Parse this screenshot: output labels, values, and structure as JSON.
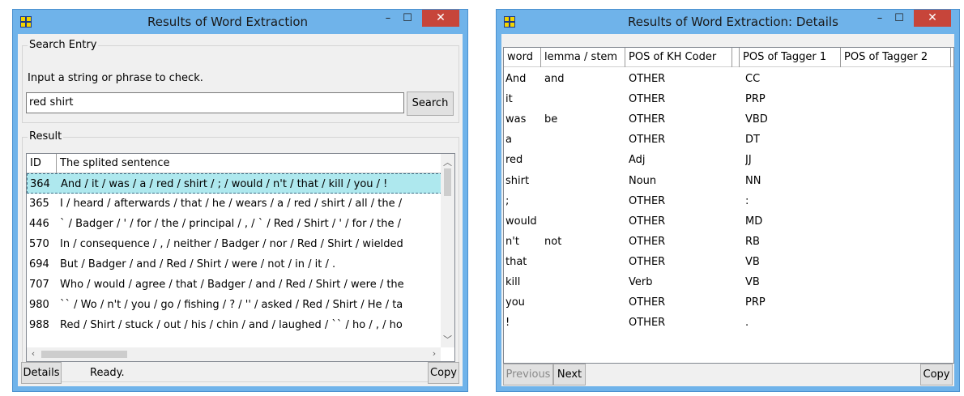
{
  "window1": {
    "title": "Results of Word Extraction",
    "search_entry_label": "Search Entry",
    "instruction": "Input a string or phrase to check.",
    "search_value": "red shirt",
    "search_button": "Search",
    "result_label": "Result",
    "columns": [
      "ID",
      "The splited sentence"
    ],
    "rows": [
      {
        "id": "364",
        "text": "And / it / was / a / red / shirt / ; / would / n't / that / kill / you / !"
      },
      {
        "id": "365",
        "text": "I / heard / afterwards / that / he / wears / a / red / shirt / all / the /"
      },
      {
        "id": "446",
        "text": "` / Badger / ' / for / the / principal / , / ` / Red / Shirt / ' / for / the /"
      },
      {
        "id": "570",
        "text": "In / consequence / , / neither / Badger / nor / Red / Shirt / wielded"
      },
      {
        "id": "694",
        "text": "But / Badger / and / Red / Shirt / were / not / in / it / ."
      },
      {
        "id": "707",
        "text": "Who / would / agree / that / Badger / and / Red / Shirt / were / the"
      },
      {
        "id": "980",
        "text": "`` / Wo / n't / you / go / fishing / ? / '' / asked / Red / Shirt / He / ta"
      },
      {
        "id": "988",
        "text": "Red / Shirt / stuck / out / his / chin / and / laughed / `` / ho / , / ho"
      }
    ],
    "details_button": "Details",
    "status": "Ready.",
    "copy_button": "Copy"
  },
  "window2": {
    "title": "Results of Word Extraction: Details",
    "columns": [
      "word",
      "lemma / stem",
      "POS of KH Coder",
      "POS of Tagger 1",
      "POS of Tagger 2"
    ],
    "rows": [
      {
        "word": "And",
        "lemma": "and",
        "kh": "OTHER",
        "t1": "CC",
        "t2": ""
      },
      {
        "word": "it",
        "lemma": "",
        "kh": "OTHER",
        "t1": "PRP",
        "t2": ""
      },
      {
        "word": "was",
        "lemma": "be",
        "kh": "OTHER",
        "t1": "VBD",
        "t2": ""
      },
      {
        "word": "a",
        "lemma": "",
        "kh": "OTHER",
        "t1": "DT",
        "t2": ""
      },
      {
        "word": "red",
        "lemma": "",
        "kh": "Adj",
        "t1": "JJ",
        "t2": ""
      },
      {
        "word": "shirt",
        "lemma": "",
        "kh": "Noun",
        "t1": "NN",
        "t2": ""
      },
      {
        "word": ";",
        "lemma": "",
        "kh": "OTHER",
        "t1": ":",
        "t2": ""
      },
      {
        "word": "would",
        "lemma": "",
        "kh": "OTHER",
        "t1": "MD",
        "t2": ""
      },
      {
        "word": "n't",
        "lemma": "not",
        "kh": "OTHER",
        "t1": "RB",
        "t2": ""
      },
      {
        "word": "that",
        "lemma": "",
        "kh": "OTHER",
        "t1": "VB",
        "t2": ""
      },
      {
        "word": "kill",
        "lemma": "",
        "kh": "Verb",
        "t1": "VB",
        "t2": ""
      },
      {
        "word": "you",
        "lemma": "",
        "kh": "OTHER",
        "t1": "PRP",
        "t2": ""
      },
      {
        "word": "!",
        "lemma": "",
        "kh": "OTHER",
        "t1": ".",
        "t2": ""
      }
    ],
    "previous_button": "Previous",
    "next_button": "Next",
    "copy_button": "Copy"
  },
  "controls": {
    "minimize": "–",
    "maximize": "☐",
    "close": "✕"
  },
  "colors": {
    "titlebar": "#6fb3ea",
    "close": "#c7453a",
    "selection": "#aee8ee"
  }
}
